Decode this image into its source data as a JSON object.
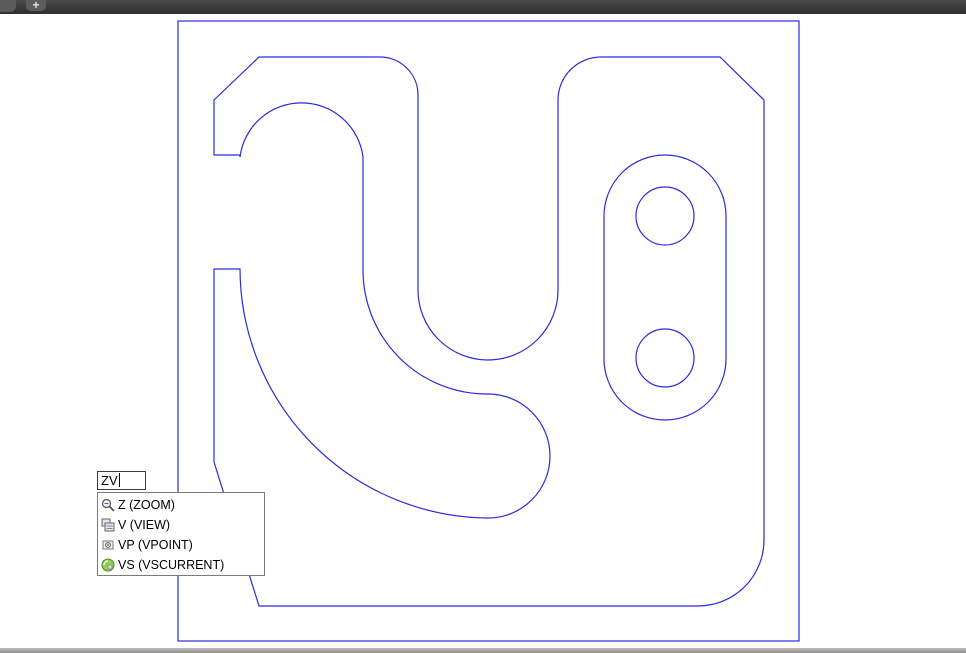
{
  "window": {
    "add_tab_glyph": "+"
  },
  "command_line": {
    "value": "ZV"
  },
  "autocomplete": {
    "items": [
      {
        "label": "Z (ZOOM)",
        "icon": "zoom-icon"
      },
      {
        "label": "V (VIEW)",
        "icon": "view-manager-icon"
      },
      {
        "label": "VP (VPOINT)",
        "icon": "vpoint-icon"
      },
      {
        "label": "VS (VSCURRENT)",
        "icon": "visual-style-icon"
      }
    ]
  },
  "colors": {
    "drawing_lines": "#2b2bd9",
    "canvas_background": "#ffffff",
    "title_bar": "#3a3a3a"
  }
}
